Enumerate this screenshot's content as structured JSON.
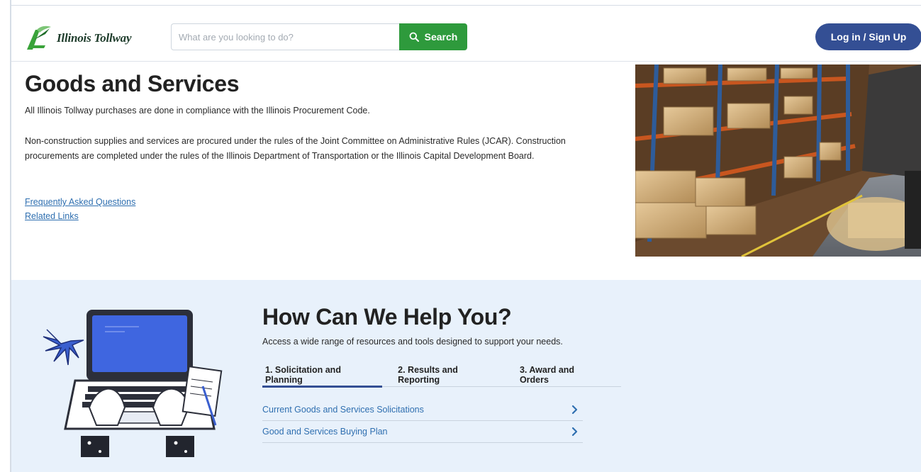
{
  "header": {
    "logo_text": "Illinois Tollway",
    "search_placeholder": "What are you looking to do?",
    "search_label": "Search",
    "login_label": "Log in / Sign Up"
  },
  "intro": {
    "title": "Goods and Services",
    "paragraph1": "All Illinois Tollway purchases are done in compliance with the Illinois Procurement Code.",
    "paragraph2": "Non-construction supplies and services are procured under the rules of the Joint Committee on Administrative Rules (JCAR). Construction procurements are completed under the rules of the Illinois Department of Transportation or the Illinois Capital Development Board.",
    "links": [
      {
        "label": "Frequently Asked Questions"
      },
      {
        "label": "Related Links"
      }
    ]
  },
  "help": {
    "title": "How Can We Help You?",
    "subtitle": "Access a wide range of resources and tools designed to support your needs.",
    "tabs": [
      {
        "label": "1. Solicitation and Planning",
        "active": true
      },
      {
        "label": "2. Results and Reporting",
        "active": false
      },
      {
        "label": "3. Award and Orders",
        "active": false
      }
    ],
    "items": [
      {
        "label": "Current Goods and Services Solicitations"
      },
      {
        "label": "Good and Services Buying Plan"
      }
    ]
  },
  "colors": {
    "brand_green": "#2e9a3c",
    "login_blue": "#344f94",
    "link_blue": "#2f6fb0",
    "help_bg": "#e8f1fb"
  },
  "icons": {
    "logo": "tollway-logo-icon",
    "search": "search-icon",
    "chevron": "chevron-right-icon"
  }
}
